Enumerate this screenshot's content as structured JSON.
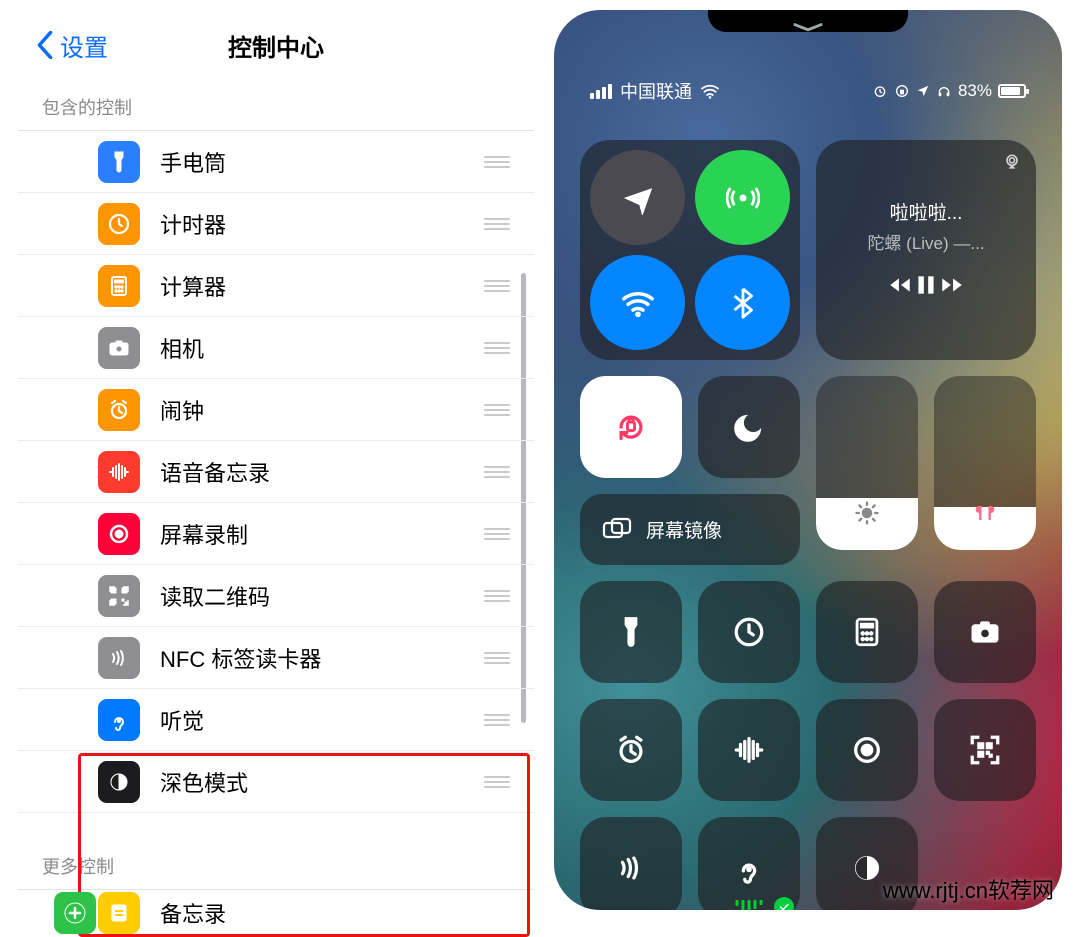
{
  "left": {
    "back_label": "设置",
    "title": "控制中心",
    "sections": {
      "included_header": "包含的控制",
      "more_header": "更多控制"
    },
    "included": [
      {
        "label": "手电筒",
        "icon": "flashlight-icon",
        "bg": "ic-blue"
      },
      {
        "label": "计时器",
        "icon": "timer-icon",
        "bg": "ic-orange"
      },
      {
        "label": "计算器",
        "icon": "calculator-icon",
        "bg": "ic-orange2"
      },
      {
        "label": "相机",
        "icon": "camera-icon",
        "bg": "ic-gray"
      },
      {
        "label": "闹钟",
        "icon": "alarm-icon",
        "bg": "ic-orange"
      },
      {
        "label": "语音备忘录",
        "icon": "voice-memo-icon",
        "bg": "ic-red"
      },
      {
        "label": "屏幕录制",
        "icon": "screen-record-icon",
        "bg": "ic-redrec"
      },
      {
        "label": "读取二维码",
        "icon": "qr-scan-icon",
        "bg": "ic-gray"
      },
      {
        "label": "NFC 标签读卡器",
        "icon": "nfc-icon",
        "bg": "ic-gray"
      },
      {
        "label": "听觉",
        "icon": "hearing-icon",
        "bg": "ic-blue2"
      },
      {
        "label": "深色模式",
        "icon": "darkmode-icon",
        "bg": "ic-dark"
      }
    ],
    "more_preview": {
      "label": "备忘录",
      "icon": "notes-icon"
    }
  },
  "right": {
    "carrier": "中国联通",
    "battery_percent": "83%",
    "media": {
      "title": "啦啦啦...",
      "subtitle": "陀螺 (Live) —..."
    },
    "mirror_label": "屏幕镜像"
  },
  "watermark": "www.rjtj.cn软荐网"
}
